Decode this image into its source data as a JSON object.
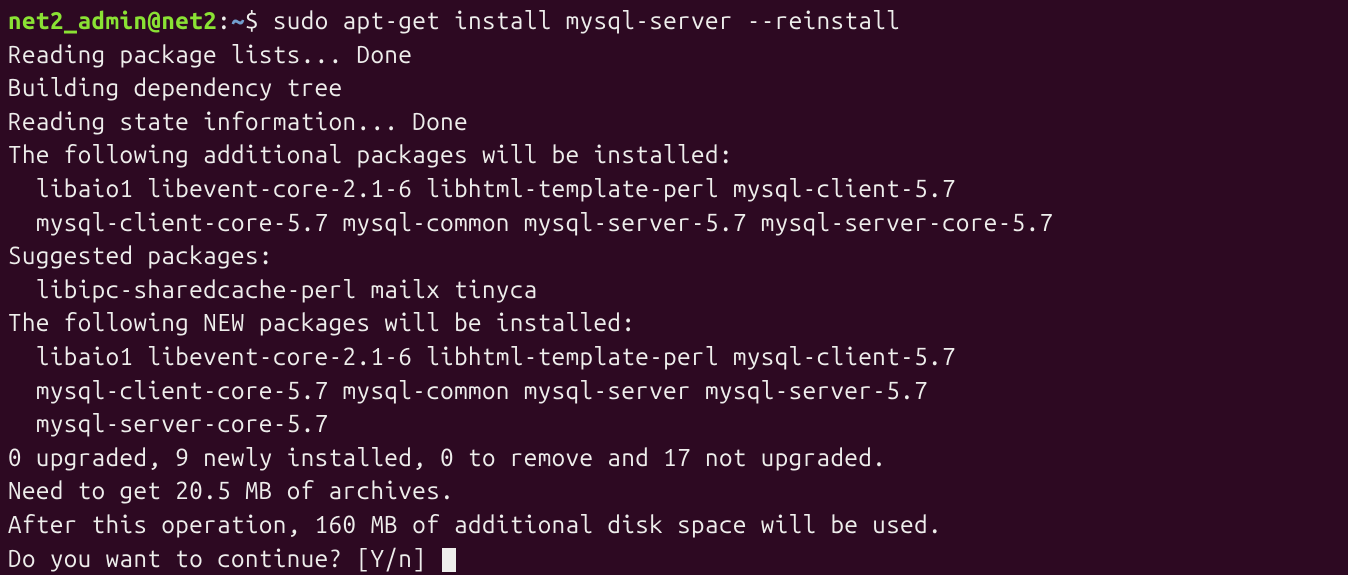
{
  "prompt": {
    "user": "net2_admin@net2",
    "path": "~",
    "symbol": "$"
  },
  "command": "sudo apt-get install mysql-server --reinstall",
  "output": {
    "line1": "Reading package lists... Done",
    "line2": "Building dependency tree",
    "line3": "Reading state information... Done",
    "line4": "The following additional packages will be installed:",
    "line5": "  libaio1 libevent-core-2.1-6 libhtml-template-perl mysql-client-5.7",
    "line6": "  mysql-client-core-5.7 mysql-common mysql-server-5.7 mysql-server-core-5.7",
    "line7": "Suggested packages:",
    "line8": "  libipc-sharedcache-perl mailx tinyca",
    "line9": "The following NEW packages will be installed:",
    "line10": "  libaio1 libevent-core-2.1-6 libhtml-template-perl mysql-client-5.7",
    "line11": "  mysql-client-core-5.7 mysql-common mysql-server mysql-server-5.7",
    "line12": "  mysql-server-core-5.7",
    "line13": "0 upgraded, 9 newly installed, 0 to remove and 17 not upgraded.",
    "line14": "Need to get 20.5 MB of archives.",
    "line15": "After this operation, 160 MB of additional disk space will be used.",
    "line16": "Do you want to continue? [Y/n] "
  }
}
